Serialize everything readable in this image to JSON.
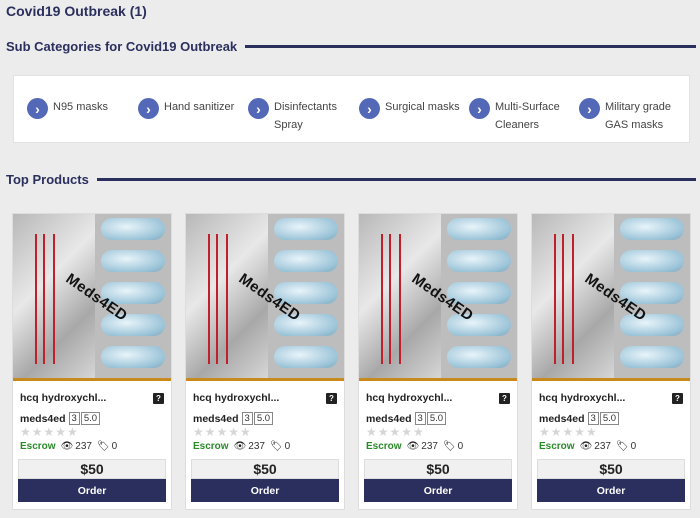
{
  "page": {
    "title": "Covid19 Outbreak (1)"
  },
  "subcategories": {
    "heading": "Sub Categories for Covid19 Outbreak",
    "items": [
      {
        "label": "N95 masks"
      },
      {
        "label": "Hand sanitizer"
      },
      {
        "label": "Disinfectants Spray"
      },
      {
        "label": "Surgical masks"
      },
      {
        "label": "Multi-Surface Cleaners"
      },
      {
        "label": "Military grade GAS masks"
      }
    ]
  },
  "top_products": {
    "heading": "Top Products",
    "cards": [
      {
        "image_text": "Meds4ED",
        "name": "hcq hydroxychl...",
        "vendor": "meds4ed",
        "vendor_level": "3",
        "vendor_rating": "5.0",
        "escrow": "Escrow",
        "views": "237",
        "tags": "0",
        "price": "$50",
        "order_label": "Order"
      },
      {
        "image_text": "Meds4ED",
        "name": "hcq hydroxychl...",
        "vendor": "meds4ed",
        "vendor_level": "3",
        "vendor_rating": "5.0",
        "escrow": "Escrow",
        "views": "237",
        "tags": "0",
        "price": "$50",
        "order_label": "Order"
      },
      {
        "image_text": "Meds4ED",
        "name": "hcq hydroxychl...",
        "vendor": "meds4ed",
        "vendor_level": "3",
        "vendor_rating": "5.0",
        "escrow": "Escrow",
        "views": "237",
        "tags": "0",
        "price": "$50",
        "order_label": "Order"
      },
      {
        "image_text": "Meds4ED",
        "name": "hcq hydroxychl...",
        "vendor": "meds4ed",
        "vendor_level": "3",
        "vendor_rating": "5.0",
        "escrow": "Escrow",
        "views": "237",
        "tags": "0",
        "price": "$50",
        "order_label": "Order"
      }
    ]
  },
  "icons": {
    "subcategory_arrow": "chevron-right-icon",
    "help": "question-icon",
    "views": "eye-icon",
    "tags": "tag-icon",
    "rating": "star-icon"
  },
  "colors": {
    "accent": "#2b2f5e",
    "arrow": "#5468b8",
    "escrow": "#2a8a2a"
  }
}
